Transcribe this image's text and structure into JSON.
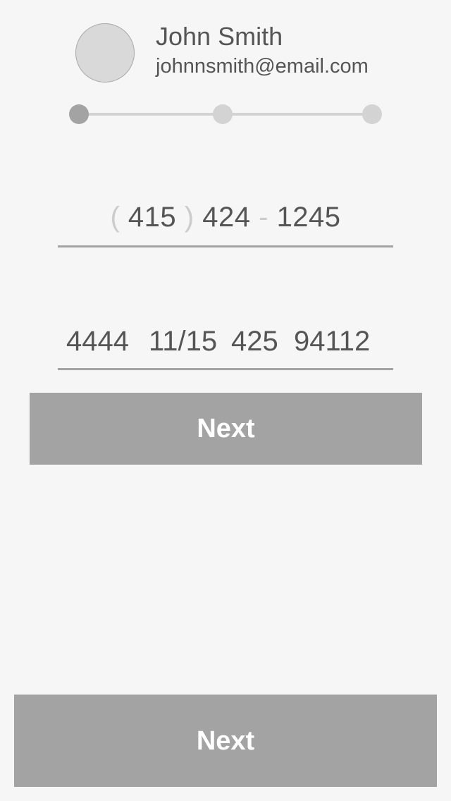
{
  "profile": {
    "name": "John Smith",
    "email": "johnnsmith@email.com"
  },
  "progress": {
    "total_steps": 3,
    "current_step": 1
  },
  "phone": {
    "open_paren": "(",
    "area_code": "415",
    "close_paren": ")",
    "prefix": "424",
    "dash": "-",
    "line": "1245"
  },
  "card": {
    "number": "4444",
    "expiry": "11/15",
    "cvv": "425",
    "zip": "94112"
  },
  "buttons": {
    "next_inline": "Next",
    "next_bottom": "Next"
  },
  "colors": {
    "background": "#f6f6f6",
    "button": "#a3a3a3",
    "active_step": "#a3a3a3",
    "inactive_step": "#d3d3d3"
  }
}
